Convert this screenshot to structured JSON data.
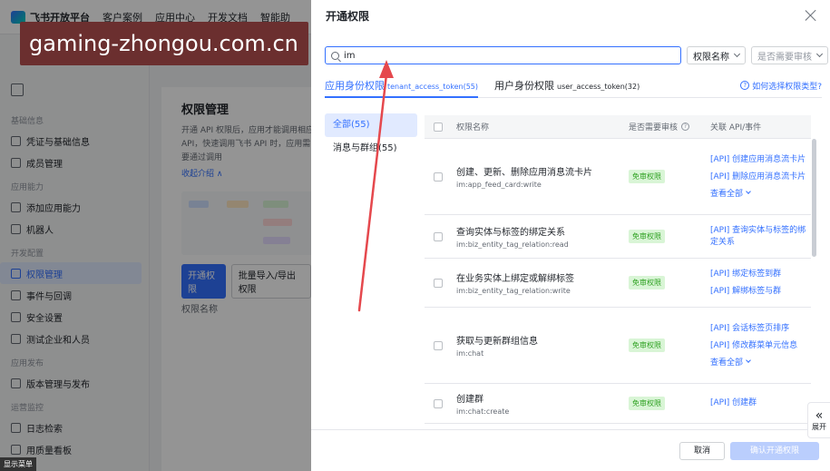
{
  "watermark": "gaming-zhongou.com.cn",
  "background": {
    "logo": "飞书开放平台",
    "topnav": [
      "客户案例",
      "应用中心",
      "开发文档",
      "智能助"
    ],
    "sidebar": [
      {
        "type": "section",
        "label": "基础信息"
      },
      {
        "type": "item",
        "label": "凭证与基础信息",
        "icon": "key-icon"
      },
      {
        "type": "item",
        "label": "成员管理",
        "icon": "users-icon"
      },
      {
        "type": "section",
        "label": "应用能力"
      },
      {
        "type": "item",
        "label": "添加应用能力",
        "icon": "grid-icon"
      },
      {
        "type": "item",
        "label": "机器人",
        "icon": "robot-icon"
      },
      {
        "type": "section",
        "label": "开发配置"
      },
      {
        "type": "item",
        "label": "权限管理",
        "icon": "shield-icon",
        "active": true
      },
      {
        "type": "item",
        "label": "事件与回调",
        "icon": "event-icon"
      },
      {
        "type": "item",
        "label": "安全设置",
        "icon": "lock-icon"
      },
      {
        "type": "item",
        "label": "测试企业和人员",
        "icon": "test-icon"
      },
      {
        "type": "section",
        "label": "应用发布"
      },
      {
        "type": "item",
        "label": "版本管理与发布",
        "icon": "version-icon"
      },
      {
        "type": "section",
        "label": "运营监控"
      },
      {
        "type": "item",
        "label": "日志检索",
        "icon": "log-icon"
      },
      {
        "type": "item",
        "label": "用质量看板",
        "icon": "board-icon"
      }
    ],
    "main": {
      "title": "权限管理",
      "desc": "开通 API 权限后，应用才能调用相应 API，快速调用飞书 API 时，应用需要通过调用",
      "link": "收起介绍 ∧",
      "btn_primary": "开通权限",
      "btn_secondary": "批量导入/导出权限",
      "th": "权限名称"
    },
    "show_menu": "显示菜单"
  },
  "modal": {
    "title": "开通权限",
    "search": {
      "value": "im",
      "placeholder": ""
    },
    "filter_name": "权限名称",
    "filter_review": "是否需要审核",
    "tabs": [
      {
        "label": "应用身份权限",
        "sub": "tenant_access_token(55)",
        "active": true
      },
      {
        "label": "用户身份权限",
        "sub": "user_access_token(32)",
        "active": false
      }
    ],
    "help_link": "如何选择权限类型?",
    "categories": [
      {
        "label": "全部(55)",
        "active": true
      },
      {
        "label": "消息与群组(55)",
        "active": false
      }
    ],
    "table": {
      "headers": {
        "name": "权限名称",
        "review": "是否需要审核",
        "api": "关联 API/事件"
      },
      "rows": [
        {
          "name": "创建、更新、删除应用消息流卡片",
          "scope": "im:app_feed_card:write",
          "badge": "免审权限",
          "apis": [
            "[API] 创建应用消息流卡片",
            "[API] 删除应用消息流卡片"
          ],
          "view_all": "查看全部"
        },
        {
          "name": "查询实体与标签的绑定关系",
          "scope": "im:biz_entity_tag_relation:read",
          "badge": "免审权限",
          "apis": [
            "[API] 查询实体与标签的绑定关系"
          ],
          "view_all": ""
        },
        {
          "name": "在业务实体上绑定或解绑标签",
          "scope": "im:biz_entity_tag_relation:write",
          "badge": "免审权限",
          "apis": [
            "[API] 绑定标签到群",
            "[API] 解绑标签与群"
          ],
          "view_all": ""
        },
        {
          "name": "获取与更新群组信息",
          "scope": "im:chat",
          "badge": "免审权限",
          "apis": [
            "[API] 会话标签页排序",
            "[API] 修改群菜单元信息"
          ],
          "view_all": "查看全部"
        },
        {
          "name": "创建群",
          "scope": "im:chat:create",
          "badge": "免审权限",
          "apis": [
            "[API] 创建群"
          ],
          "view_all": ""
        }
      ]
    },
    "footer": {
      "cancel": "取消",
      "confirm": "确认开通权限"
    }
  },
  "expand": {
    "icon": "«",
    "label": "展开"
  },
  "colors": {
    "accent": "#3370ff",
    "badge_bg": "#d9f5d6",
    "badge_text": "#2ea121",
    "arrow": "#e5484d"
  }
}
